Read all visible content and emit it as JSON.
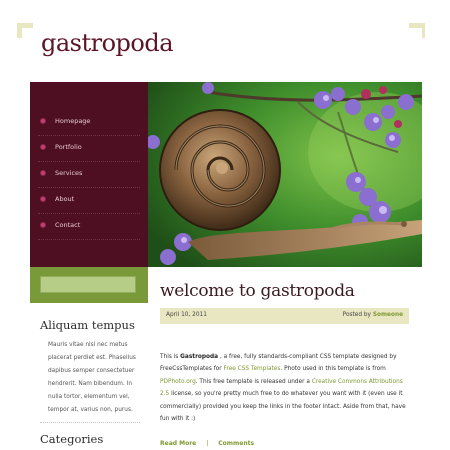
{
  "site": {
    "logo": "gastropoda",
    "colors": {
      "maroon": "#4e0f22",
      "olive": "#7a9a3a",
      "beige": "#e9e6c2",
      "link_green": "#7c9a31"
    }
  },
  "nav": {
    "items": [
      {
        "label": "Homepage"
      },
      {
        "label": "Portfolio"
      },
      {
        "label": "Services"
      },
      {
        "label": "About"
      },
      {
        "label": "Contact"
      }
    ]
  },
  "sidebar": {
    "search_placeholder": "",
    "section1_title": "Aliquam tempus",
    "section1_text": "Mauris vitae nisl nec metus placerat perdiet est. Phasellus dapibus semper consectetuer hendrerit. Nam bibendum. In nulla tortor, elementum vel, tempor at, varius non, purus.",
    "section2_title": "Categories"
  },
  "hero": {
    "image": "snail-on-purple-flowers-photo"
  },
  "post": {
    "title": "welcome to gastropoda",
    "date": "April 10, 2011",
    "posted_by_label": "Posted by",
    "author": "Someone",
    "body": {
      "p1": "This is ",
      "site_name": "Gastropoda",
      "p2": " , a free, fully standards-compliant CSS template designed by FreeCssTemplates for ",
      "link1": "Free CSS Templates",
      "p3": ". Photo used in this template is from ",
      "link2": "PDPhoto.org",
      "p4": ". This free template is released under a ",
      "link3": "Creative Commons Attributions 2.5",
      "p5": " license, so you're pretty much free to do whatever you want with it (even use it commercially) provided you keep the links in the footer intact. Aside from that, have fun with it :)"
    },
    "read_more": "Read More",
    "separator": "|",
    "comments": "Comments"
  }
}
